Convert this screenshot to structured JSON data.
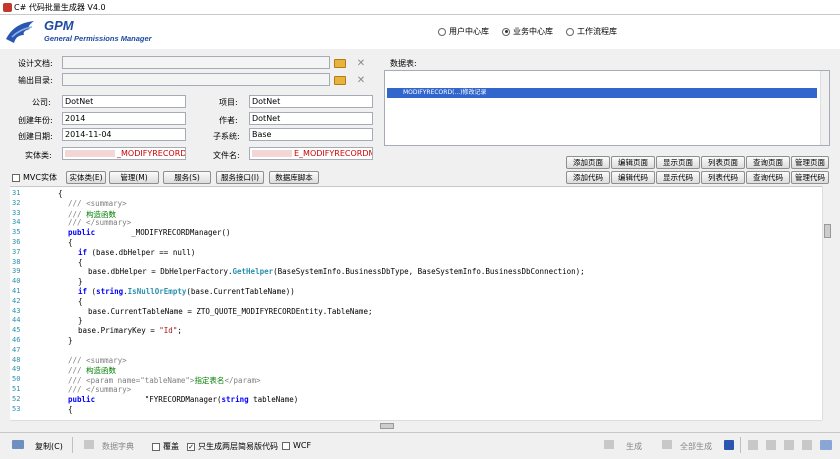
{
  "window": {
    "title": "C# 代码批量生成器 V4.0"
  },
  "brand": {
    "name": "GPM",
    "subtitle": "General Permissions Manager"
  },
  "db_options": [
    {
      "label": "用户中心库",
      "selected": false
    },
    {
      "label": "业务中心库",
      "selected": true
    },
    {
      "label": "工作流程库",
      "selected": false
    }
  ],
  "form": {
    "design_doc_label": "设计文档:",
    "output_dir_label": "输出目录:",
    "company_label": "公司:",
    "company_value": "DotNet",
    "project_label": "项目:",
    "project_value": "DotNet",
    "year_label": "创建年份:",
    "year_value": "2014",
    "author_label": "作者:",
    "author_value": "DotNet",
    "date_label": "创建日期:",
    "date_value": "2014-11-04",
    "subsystem_label": "子系统:",
    "subsystem_value": "Base",
    "entity_label": "实体类:",
    "entity_value": "_MODIFYRECORDManag",
    "filename_label": "文件名:",
    "filename_value": "E_MODIFYRECORDManag"
  },
  "datatable": {
    "label": "数据表:",
    "selected_row": "MODIFYRECORD(...)修改记录"
  },
  "page_buttons": [
    "添加页面",
    "编辑页面",
    "显示页面",
    "列表页面",
    "查询页面",
    "管理页面"
  ],
  "code_buttons": [
    "添加代码",
    "编辑代码",
    "显示代码",
    "列表代码",
    "查询代码",
    "管理代码"
  ],
  "mvc_label": "MVC实体",
  "tabs": [
    "实体类(E)",
    "管理(M)",
    "服务(S)",
    "服务接口(I)",
    "数据库脚本"
  ],
  "code_lines": [
    {
      "n": "31",
      "indent": 2,
      "parts": [
        {
          "t": "{",
          "c": "plain"
        }
      ]
    },
    {
      "n": "32",
      "indent": 3,
      "parts": [
        {
          "t": "/// ",
          "c": "gray"
        },
        {
          "t": "<summary>",
          "c": "gray"
        }
      ]
    },
    {
      "n": "33",
      "indent": 3,
      "parts": [
        {
          "t": "/// ",
          "c": "gray"
        },
        {
          "t": "构造函数",
          "c": "green"
        }
      ]
    },
    {
      "n": "34",
      "indent": 3,
      "parts": [
        {
          "t": "/// </summary>",
          "c": "gray"
        }
      ]
    },
    {
      "n": "35",
      "indent": 3,
      "parts": [
        {
          "t": "public ",
          "c": "kw"
        },
        {
          "t": "       _MODIFYRECORDManager()",
          "c": "plain"
        }
      ]
    },
    {
      "n": "36",
      "indent": 3,
      "parts": [
        {
          "t": "{",
          "c": "plain"
        }
      ]
    },
    {
      "n": "37",
      "indent": 4,
      "parts": [
        {
          "t": "if ",
          "c": "kw"
        },
        {
          "t": "(base.dbHelper == null)",
          "c": "plain"
        }
      ]
    },
    {
      "n": "38",
      "indent": 4,
      "parts": [
        {
          "t": "{",
          "c": "plain"
        }
      ]
    },
    {
      "n": "39",
      "indent": 5,
      "parts": [
        {
          "t": "base.dbHelper = DbHelperFactory.",
          "c": "plain"
        },
        {
          "t": "GetHelper",
          "c": "teal"
        },
        {
          "t": "(BaseSystemInfo.BusinessDbType, BaseSystemInfo.BusinessDbConnection);",
          "c": "plain"
        }
      ]
    },
    {
      "n": "40",
      "indent": 4,
      "parts": [
        {
          "t": "}",
          "c": "plain"
        }
      ]
    },
    {
      "n": "41",
      "indent": 4,
      "parts": [
        {
          "t": "if ",
          "c": "kw"
        },
        {
          "t": "(",
          "c": "plain"
        },
        {
          "t": "string",
          "c": "kw"
        },
        {
          "t": ".",
          "c": "plain"
        },
        {
          "t": "IsNullOrEmpty",
          "c": "teal"
        },
        {
          "t": "(base.CurrentTableName))",
          "c": "plain"
        }
      ]
    },
    {
      "n": "42",
      "indent": 4,
      "parts": [
        {
          "t": "{",
          "c": "plain"
        }
      ]
    },
    {
      "n": "43",
      "indent": 5,
      "parts": [
        {
          "t": "base.CurrentTableName = ZTO_QUOTE_MODIFYRECORDEntity.TableName;",
          "c": "plain"
        }
      ]
    },
    {
      "n": "44",
      "indent": 4,
      "parts": [
        {
          "t": "}",
          "c": "plain"
        }
      ]
    },
    {
      "n": "45",
      "indent": 4,
      "parts": [
        {
          "t": "base.PrimaryKey = ",
          "c": "plain"
        },
        {
          "t": "\"Id\"",
          "c": "str"
        },
        {
          "t": ";",
          "c": "plain"
        }
      ]
    },
    {
      "n": "46",
      "indent": 3,
      "parts": [
        {
          "t": "}",
          "c": "plain"
        }
      ]
    },
    {
      "n": "47",
      "indent": 0,
      "parts": []
    },
    {
      "n": "48",
      "indent": 3,
      "parts": [
        {
          "t": "/// <summary>",
          "c": "gray"
        }
      ]
    },
    {
      "n": "49",
      "indent": 3,
      "parts": [
        {
          "t": "/// ",
          "c": "gray"
        },
        {
          "t": "构造函数",
          "c": "green"
        }
      ]
    },
    {
      "n": "50",
      "indent": 3,
      "parts": [
        {
          "t": "/// <param name=\"tableName\">",
          "c": "gray"
        },
        {
          "t": "指定表名",
          "c": "green"
        },
        {
          "t": "</param>",
          "c": "gray"
        }
      ]
    },
    {
      "n": "51",
      "indent": 3,
      "parts": [
        {
          "t": "/// </summary>",
          "c": "gray"
        }
      ]
    },
    {
      "n": "52",
      "indent": 3,
      "parts": [
        {
          "t": "public ",
          "c": "kw"
        },
        {
          "t": "          \"FYRECORDManager(",
          "c": "plain"
        },
        {
          "t": "string ",
          "c": "kw"
        },
        {
          "t": "tableName)",
          "c": "plain"
        }
      ]
    },
    {
      "n": "53",
      "indent": 3,
      "parts": [
        {
          "t": "{",
          "c": "plain"
        }
      ]
    }
  ],
  "bottom": {
    "copy": "复制(C)",
    "data_dict": "数据字典",
    "overwrite": "覆盖",
    "only_simple": "只生成两层简易版代码",
    "wcf": "WCF",
    "generate": "生成",
    "generate_all": "全部生成"
  },
  "colors": {
    "keyword": "#0000ff",
    "comment": "#808080",
    "green": "#008000",
    "teal": "#2b91af",
    "string": "#a31515",
    "selection": "#3366cc",
    "brand": "#1f4aa0"
  }
}
